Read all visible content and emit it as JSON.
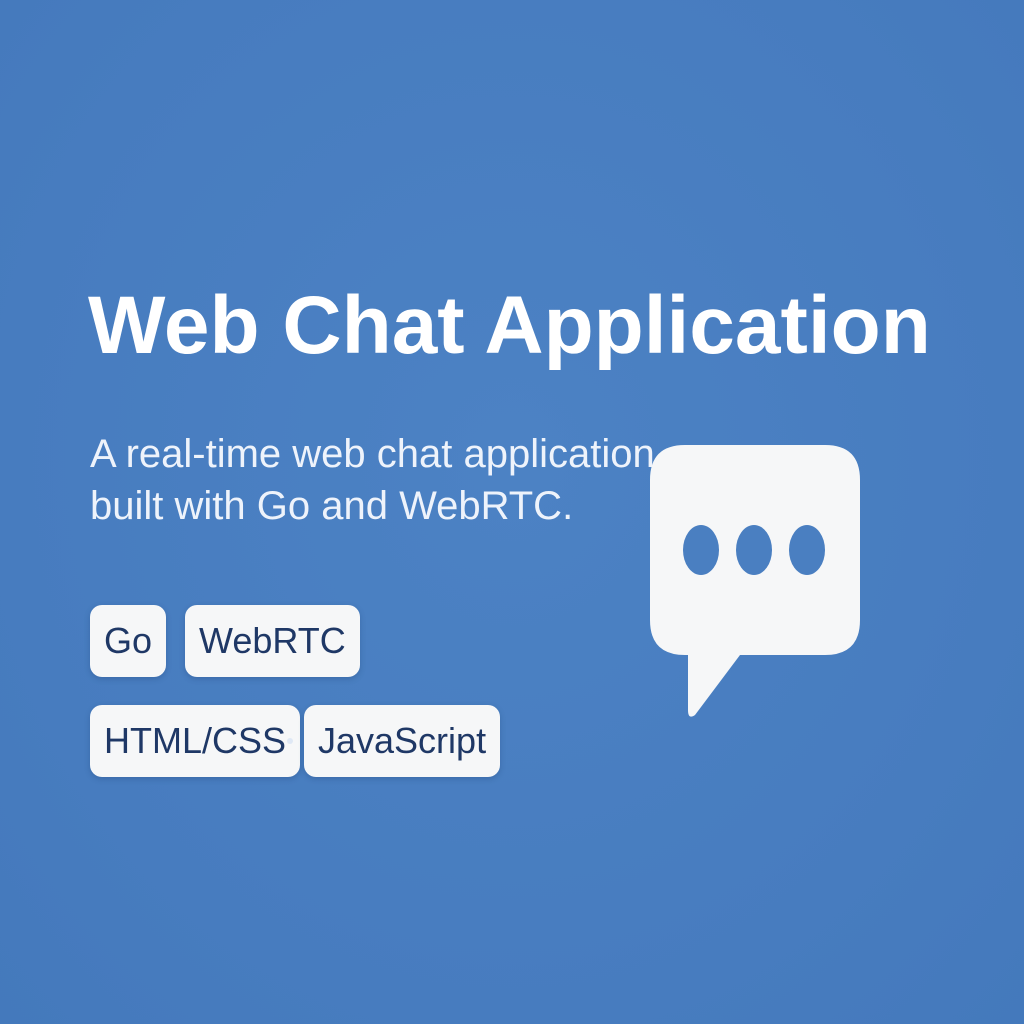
{
  "title": "Web Chat Application",
  "subtitle": {
    "line1": "A real-time web chat application",
    "line2": "built with Go and WebRTC."
  },
  "tags": {
    "go": "Go",
    "webrtc": "WebRTC",
    "html_css": "HTML/CSS",
    "javascript": "JavaScript"
  },
  "icons": {
    "chat": "chat-bubble-icon"
  },
  "colors": {
    "background": "#4a7fc1",
    "title_text": "#ffffff",
    "tag_background": "#f6f7f8",
    "tag_text": "#1f3866",
    "bubble": "#f6f7f8"
  }
}
